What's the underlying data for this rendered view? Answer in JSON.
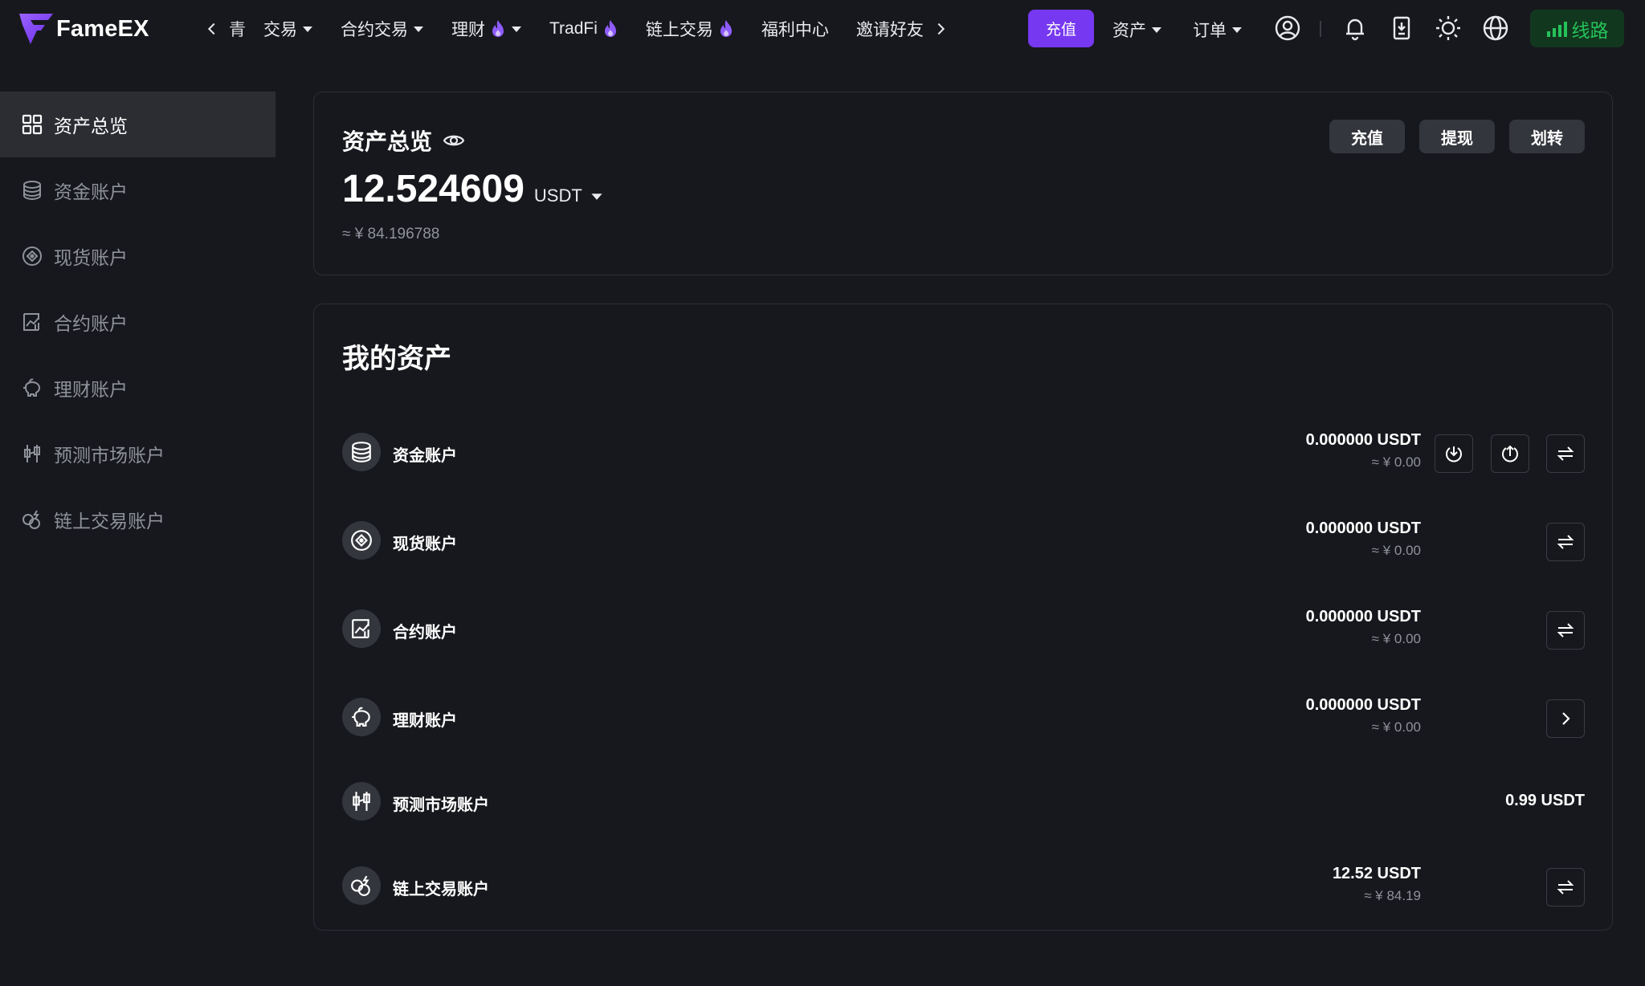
{
  "brand": {
    "name": "FameEX"
  },
  "nav": {
    "partial": "青",
    "items": [
      {
        "label": "交易"
      },
      {
        "label": "合约交易"
      },
      {
        "label": "理财"
      },
      {
        "label": "TradFi"
      },
      {
        "label": "链上交易"
      },
      {
        "label": "福利中心"
      },
      {
        "label": "邀请好友"
      }
    ],
    "recharge": "充值",
    "assets": "资产",
    "orders": "订单",
    "line": "线路"
  },
  "sidebar": {
    "items": [
      {
        "label": "资产总览",
        "icon": "grid-icon"
      },
      {
        "label": "资金账户",
        "icon": "database-icon"
      },
      {
        "label": "现货账户",
        "icon": "spot-icon"
      },
      {
        "label": "合约账户",
        "icon": "chart-icon"
      },
      {
        "label": "理财账户",
        "icon": "piggy-icon"
      },
      {
        "label": "预测市场账户",
        "icon": "candles-icon"
      },
      {
        "label": "链上交易账户",
        "icon": "chain-icon"
      }
    ]
  },
  "overview": {
    "title": "资产总览",
    "amount": "12.524609",
    "unit": "USDT",
    "cny": "≈ ¥ 84.196788",
    "buttons": {
      "deposit": "充值",
      "withdraw": "提现",
      "transfer": "划转"
    }
  },
  "assets": {
    "title": "我的资产",
    "rows": [
      {
        "name": "资金账户",
        "value": "0.000000 USDT",
        "cny": "≈ ¥ 0.00"
      },
      {
        "name": "现货账户",
        "value": "0.000000 USDT",
        "cny": "≈ ¥ 0.00"
      },
      {
        "name": "合约账户",
        "value": "0.000000 USDT",
        "cny": "≈ ¥ 0.00"
      },
      {
        "name": "理财账户",
        "value": "0.000000 USDT",
        "cny": "≈ ¥ 0.00"
      },
      {
        "name": "预测市场账户",
        "value": "0.99 USDT"
      },
      {
        "name": "链上交易账户",
        "value": "12.52 USDT",
        "cny": "≈ ¥ 84.19"
      }
    ]
  },
  "colors": {
    "background": "#17181d",
    "accent": "#7638f0",
    "active_bg": "#2b2d33",
    "line_green": "#25c25a",
    "fire": "#8f5cff"
  }
}
